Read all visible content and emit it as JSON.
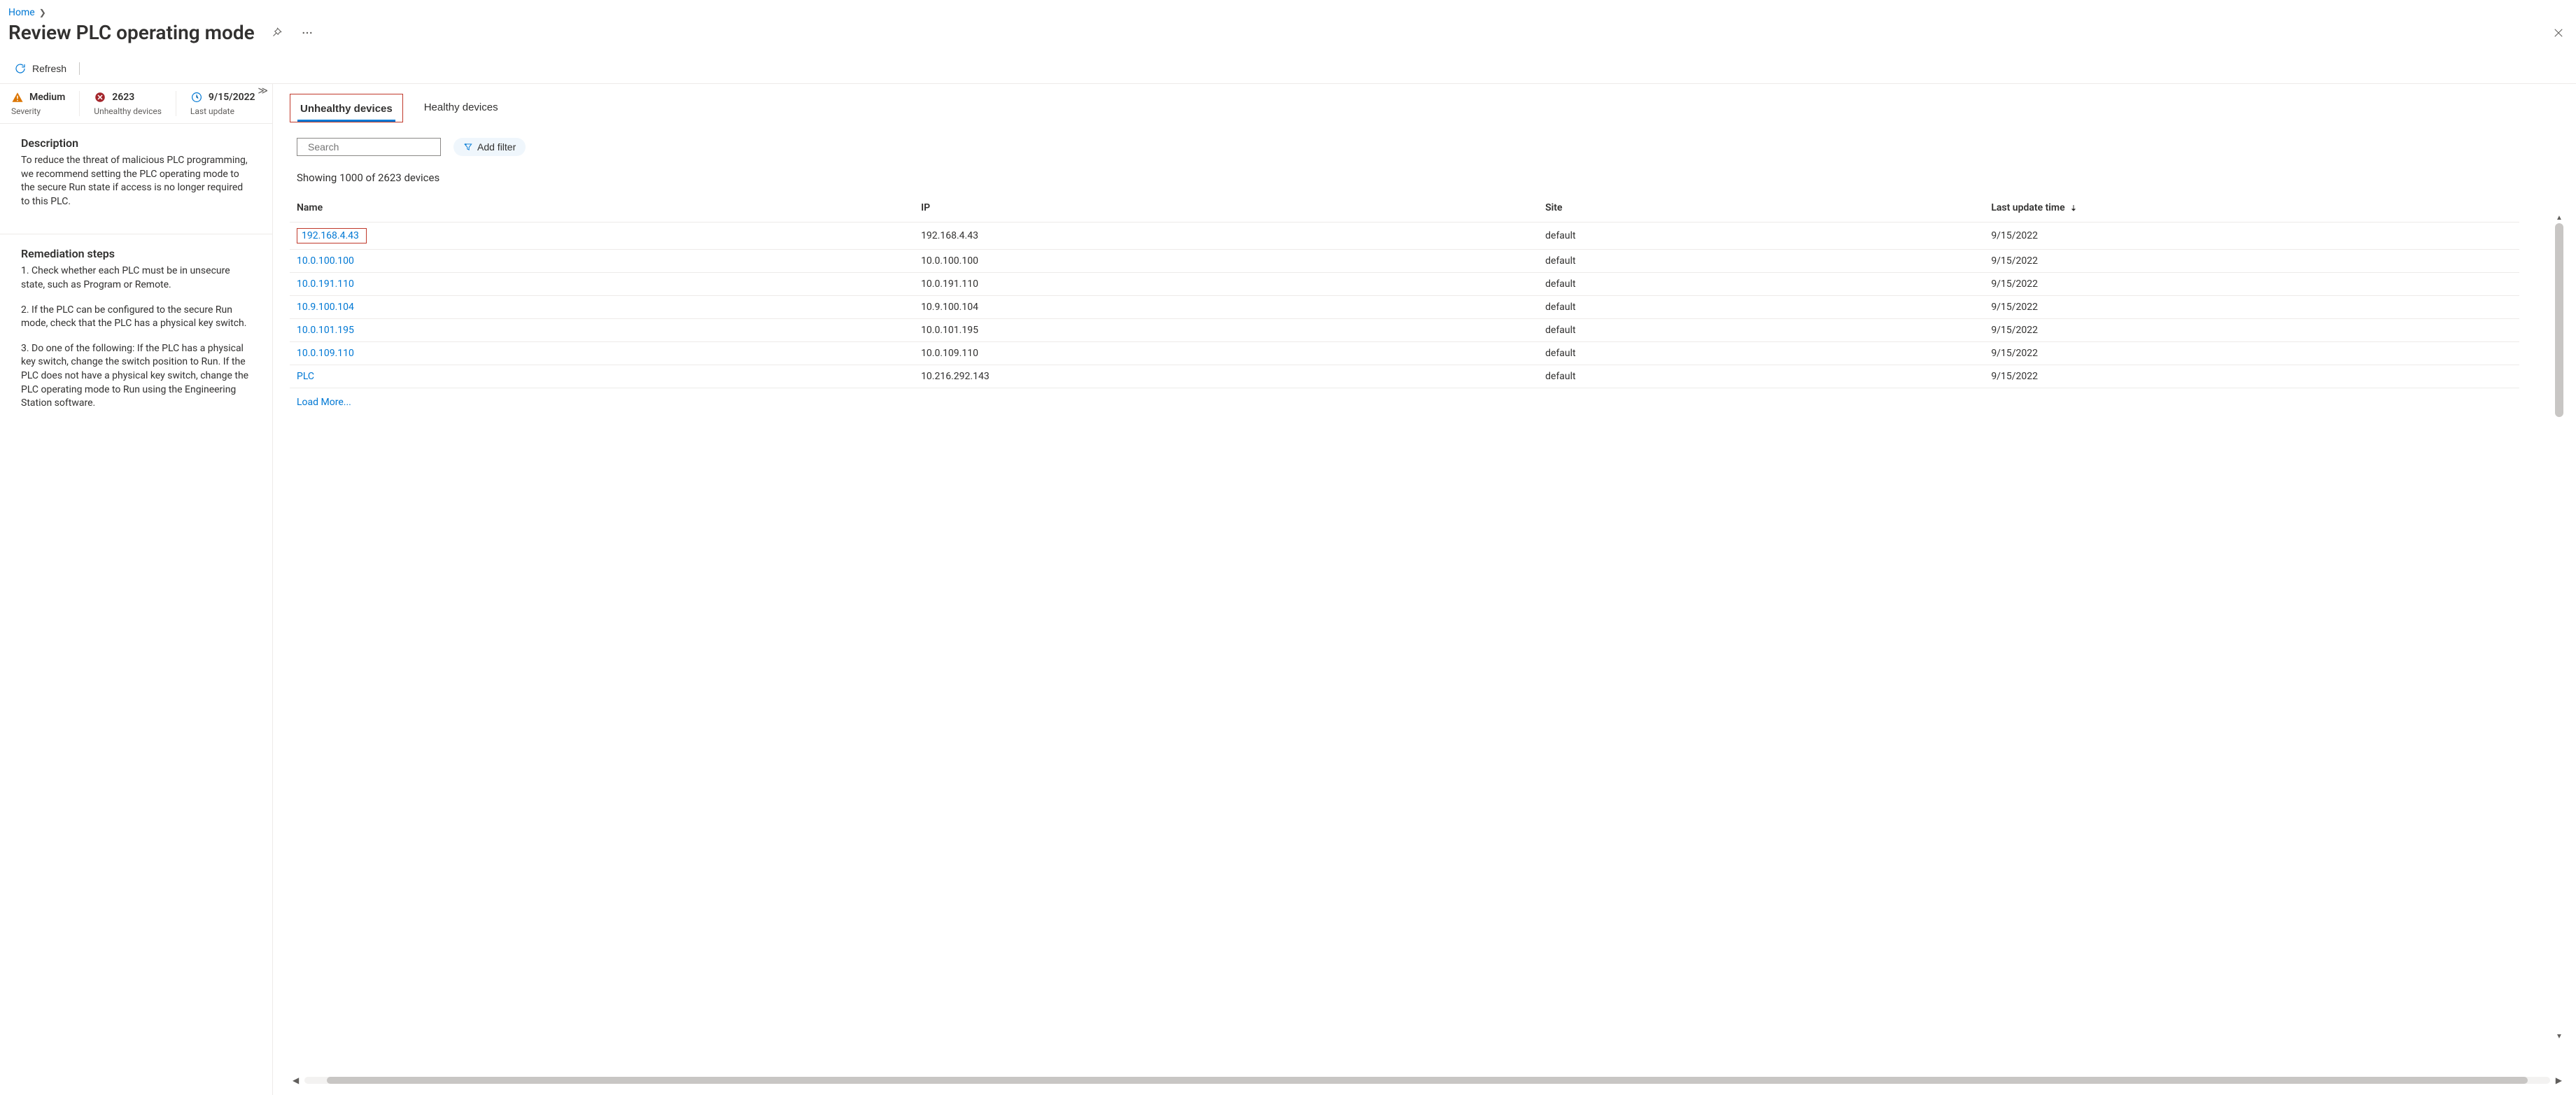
{
  "breadcrumb": {
    "home": "Home"
  },
  "header": {
    "title": "Review PLC operating mode",
    "pin_tooltip": "Pin",
    "more_tooltip": "More",
    "close_tooltip": "Close"
  },
  "toolbar": {
    "refresh": "Refresh"
  },
  "summary": {
    "severity": {
      "value": "Medium",
      "label": "Severity"
    },
    "unhealthy": {
      "value": "2623",
      "label": "Unhealthy devices"
    },
    "last_update": {
      "value": "9/15/2022",
      "label": "Last update"
    }
  },
  "description": {
    "heading": "Description",
    "text": "To reduce the threat of malicious PLC programming, we recommend setting the PLC operating mode to the secure Run state if access is no longer required to this PLC."
  },
  "remediation": {
    "heading": "Remediation steps",
    "step1": "1. Check whether each PLC must be in unsecure state, such as Program or Remote.",
    "step2": "2. If the PLC can be configured to the secure Run mode, check that the PLC has a physical key switch.",
    "step3": "3. Do one of the following: If the PLC has a physical key switch, change the switch position to Run. If the PLC does not have a physical key switch, change the PLC operating mode to Run using the Engineering Station software."
  },
  "tabs": {
    "unhealthy": "Unhealthy devices",
    "healthy": "Healthy devices"
  },
  "filters": {
    "search_placeholder": "Search",
    "add_filter": "Add filter"
  },
  "table": {
    "count_text": "Showing 1000 of 2623 devices",
    "columns": {
      "name": "Name",
      "ip": "IP",
      "site": "Site",
      "last_update": "Last update time"
    },
    "rows": [
      {
        "name": "192.168.4.43",
        "ip": "192.168.4.43",
        "site": "default",
        "last_update": "9/15/2022"
      },
      {
        "name": "10.0.100.100",
        "ip": "10.0.100.100",
        "site": "default",
        "last_update": "9/15/2022"
      },
      {
        "name": "10.0.191.110",
        "ip": "10.0.191.110",
        "site": "default",
        "last_update": "9/15/2022"
      },
      {
        "name": "10.9.100.104",
        "ip": "10.9.100.104",
        "site": "default",
        "last_update": "9/15/2022"
      },
      {
        "name": "10.0.101.195",
        "ip": "10.0.101.195",
        "site": "default",
        "last_update": "9/15/2022"
      },
      {
        "name": "10.0.109.110",
        "ip": "10.0.109.110",
        "site": "default",
        "last_update": "9/15/2022"
      },
      {
        "name": "PLC",
        "ip": "10.216.292.143",
        "site": "default",
        "last_update": "9/15/2022"
      }
    ],
    "load_more": "Load More..."
  }
}
